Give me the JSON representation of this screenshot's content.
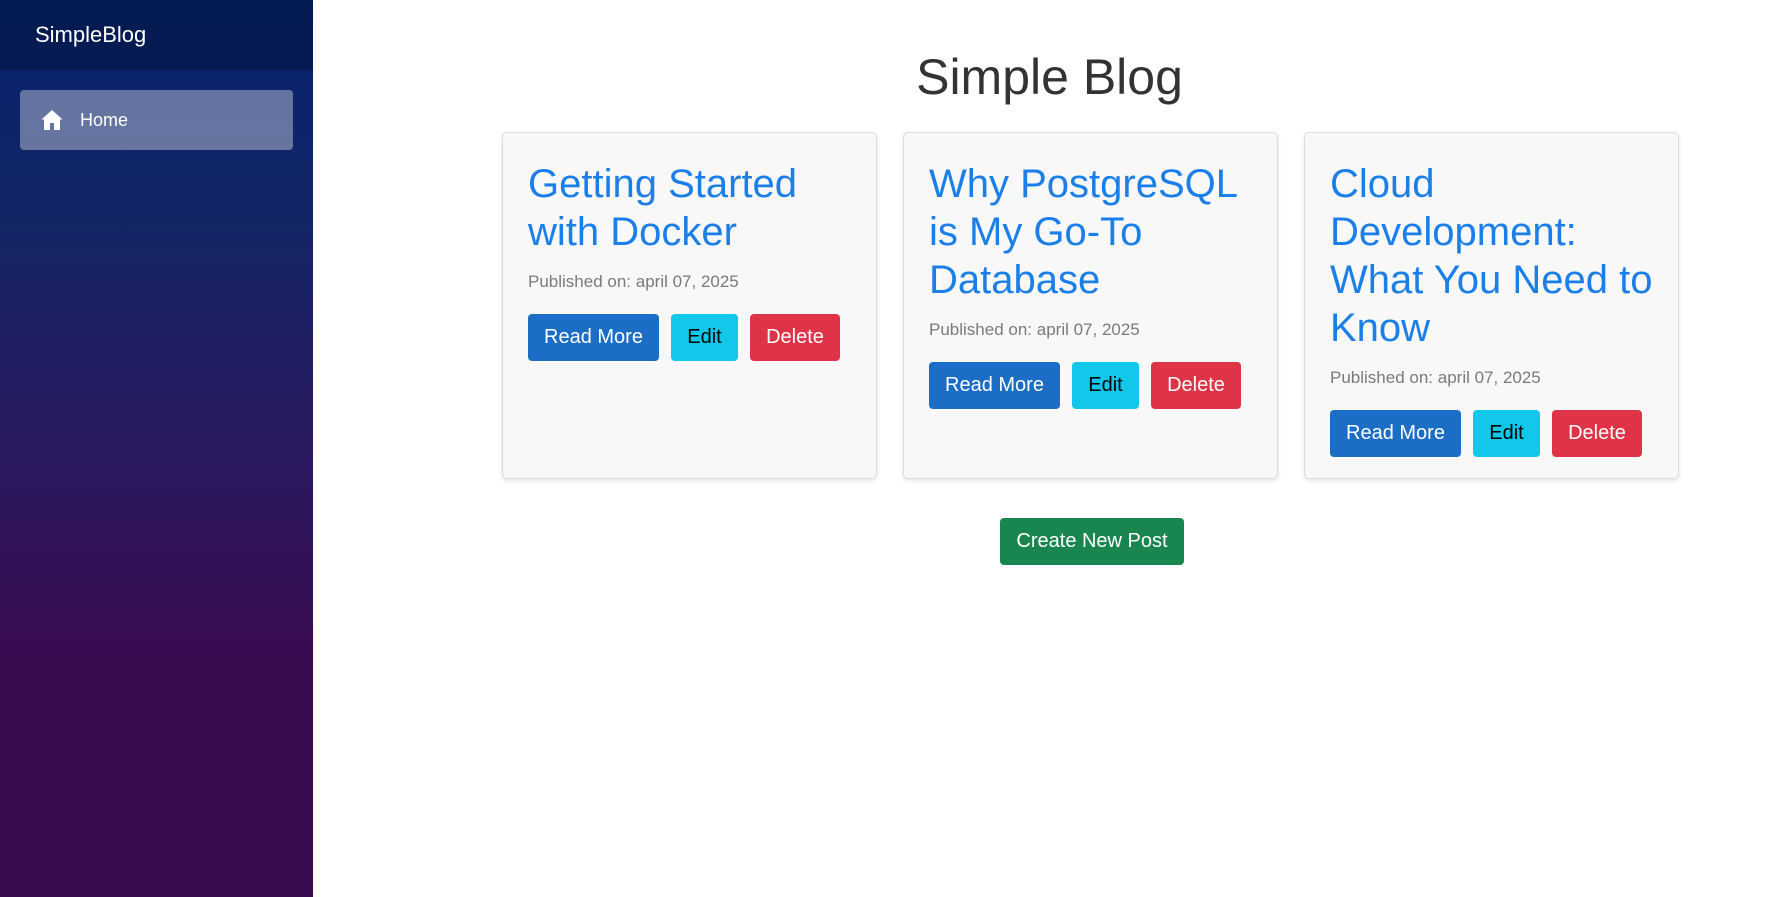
{
  "sidebar": {
    "brand": "SimpleBlog",
    "items": [
      {
        "label": "Home",
        "icon": "home-icon",
        "active": true
      }
    ]
  },
  "main": {
    "title": "Simple Blog",
    "posts": [
      {
        "title": "Getting Started with Docker",
        "published": "Published on: april 07, 2025",
        "read_more": "Read More",
        "edit": "Edit",
        "delete": "Delete"
      },
      {
        "title": "Why PostgreSQL is My Go-To Database",
        "published": "Published on: april 07, 2025",
        "read_more": "Read More",
        "edit": "Edit",
        "delete": "Delete"
      },
      {
        "title": "Cloud Development: What You Need to Know",
        "published": "Published on: april 07, 2025",
        "read_more": "Read More",
        "edit": "Edit",
        "delete": "Delete"
      }
    ],
    "create_button": "Create New Post"
  },
  "colors": {
    "link": "#1a7fe8",
    "primary": "#1c6dc6",
    "info": "#11c8ea",
    "danger": "#df3347",
    "success": "#198650"
  }
}
